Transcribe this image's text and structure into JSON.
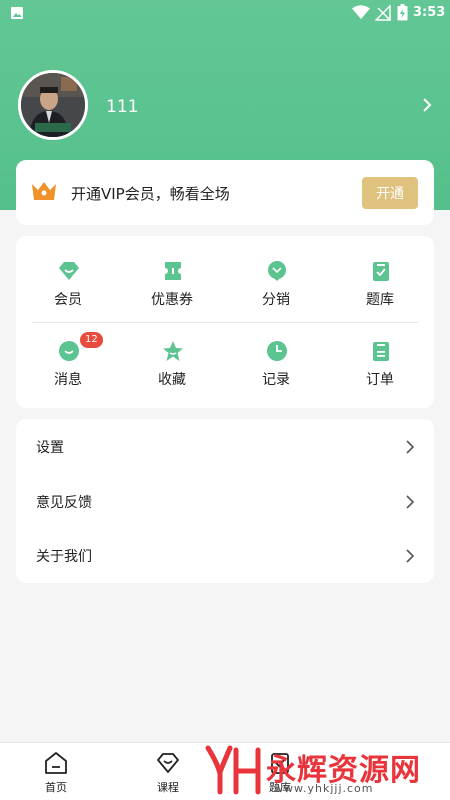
{
  "status_bar": {
    "time": "3:53"
  },
  "profile": {
    "username": "111"
  },
  "vip": {
    "text": "开通VIP会员，畅看全场",
    "button": "开通"
  },
  "grid": {
    "row1": [
      {
        "label": "会员",
        "icon": "diamond-icon"
      },
      {
        "label": "优惠券",
        "icon": "ticket-icon"
      },
      {
        "label": "分销",
        "icon": "share-icon"
      },
      {
        "label": "题库",
        "icon": "clipboard-check-icon"
      }
    ],
    "row2": [
      {
        "label": "消息",
        "icon": "message-icon",
        "badge": "12"
      },
      {
        "label": "收藏",
        "icon": "star-icon"
      },
      {
        "label": "记录",
        "icon": "clock-icon"
      },
      {
        "label": "订单",
        "icon": "order-icon"
      }
    ]
  },
  "menu": [
    {
      "label": "设置"
    },
    {
      "label": "意见反馈"
    },
    {
      "label": "关于我们"
    }
  ],
  "tabs": [
    {
      "label": "首页",
      "icon": "home-icon"
    },
    {
      "label": "课程",
      "icon": "course-icon"
    },
    {
      "label": "题库",
      "icon": "question-bank-icon"
    }
  ],
  "watermark": {
    "title": "永辉资源网",
    "url": "www.yhkjjj.com"
  },
  "colors": {
    "primary": "#5cc490",
    "gold": "#e0c27f",
    "badge": "#e84a3c",
    "watermark": "#e8343a"
  }
}
